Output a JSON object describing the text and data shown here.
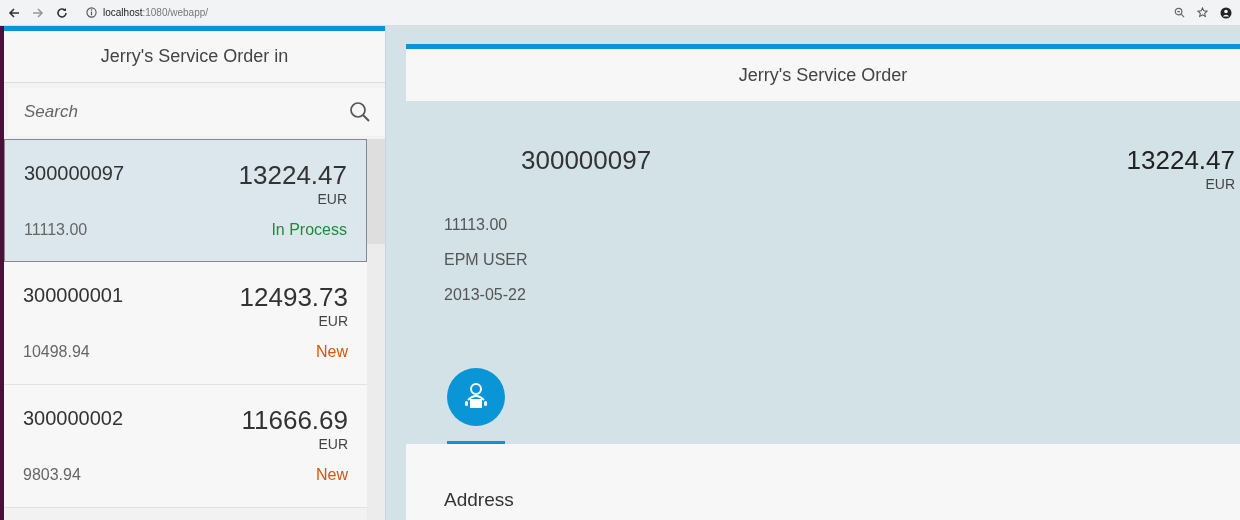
{
  "browser": {
    "url_host": "localhost",
    "url_path": ":1080/webapp/"
  },
  "master": {
    "title": "Jerry's Service Order in",
    "search": {
      "placeholder": "Search"
    },
    "items": [
      {
        "id": "300000097",
        "amount": "13224.47",
        "currency": "EUR",
        "net": "11113.00",
        "status": "In Process",
        "color": "#1f8a3b",
        "selected": true
      },
      {
        "id": "300000001",
        "amount": "12493.73",
        "currency": "EUR",
        "net": "10498.94",
        "status": "New",
        "color": "#d9550a",
        "selected": false
      },
      {
        "id": "300000002",
        "amount": "11666.69",
        "currency": "EUR",
        "net": "9803.94",
        "status": "New",
        "color": "#d9550a",
        "selected": false
      }
    ]
  },
  "detail": {
    "title": "Jerry's Service Order",
    "id": "300000097",
    "amount": "13224.47",
    "currency": "EUR",
    "attributes": [
      "11113.00",
      "EPM USER",
      "2013-05-22"
    ],
    "tabs": [
      {
        "kind": "customer",
        "selected": true
      }
    ],
    "section_title": "Address"
  }
}
